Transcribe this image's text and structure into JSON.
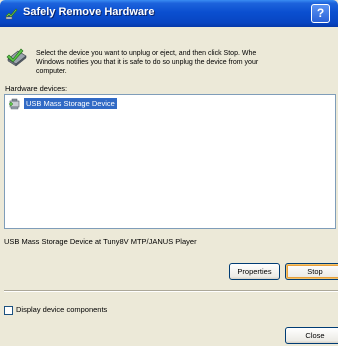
{
  "window": {
    "title": "Safely Remove Hardware",
    "help_button": "?"
  },
  "instructions": {
    "lines": [
      "Select the device you want to unplug or eject, and then click Stop. Whe",
      "Windows notifies you that it is safe to do so unplug the device from your",
      "computer."
    ]
  },
  "hardware_devices": {
    "label": "Hardware devices:",
    "items": [
      {
        "label": "USB Mass Storage Device",
        "icon": "usb-device-icon",
        "selected": true
      }
    ]
  },
  "device_description": "USB Mass Storage Device at Tuny8V MTP/JANUS Player",
  "buttons": {
    "properties": "Properties",
    "stop": "Stop",
    "close": "Close"
  },
  "display_components": {
    "label": "Display device components",
    "checked": false
  },
  "colors": {
    "titlebar": "#0a4fd0",
    "selection": "#316ac5",
    "dialog_background": "#ece9d8"
  }
}
